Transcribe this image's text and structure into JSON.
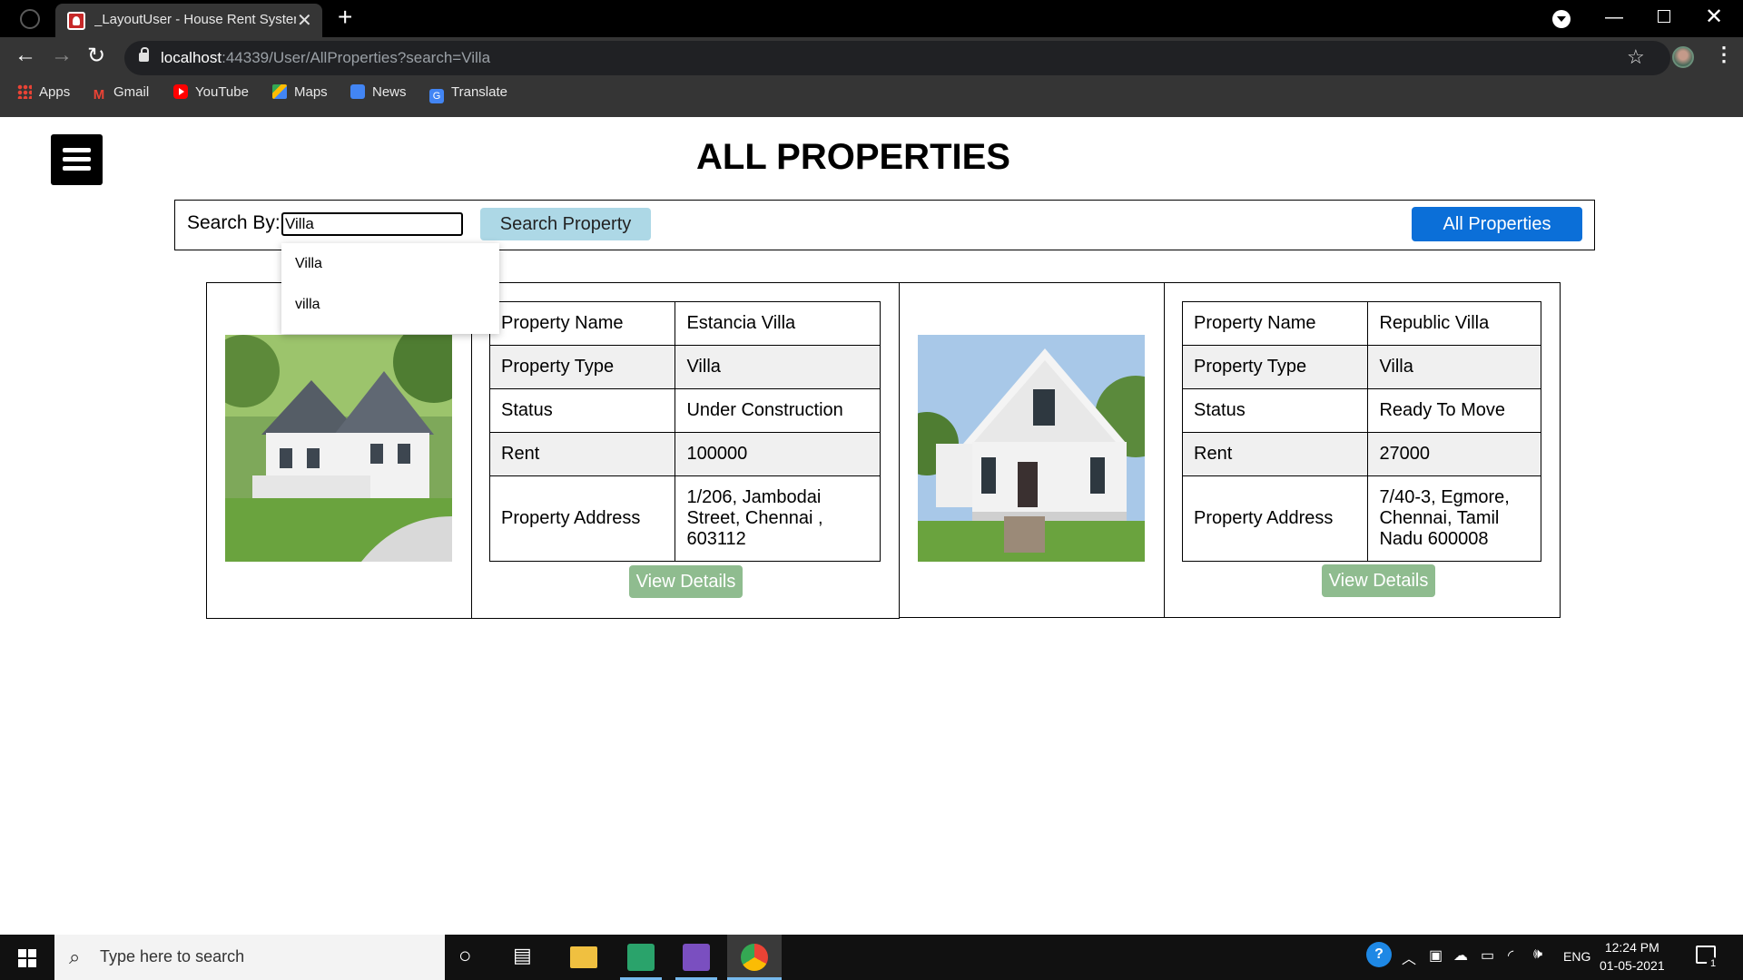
{
  "browser": {
    "tab_title": "_LayoutUser - House Rent System",
    "url_host": "localhost",
    "url_rest": ":44339/User/AllProperties?search=Villa",
    "bookmarks": [
      "Apps",
      "Gmail",
      "YouTube",
      "Maps",
      "News",
      "Translate"
    ]
  },
  "page": {
    "title": "ALL PROPERTIES",
    "search_label": "Search By:",
    "search_value": "Villa",
    "search_button": "Search Property",
    "all_button": "All Properties",
    "suggestions": [
      "Villa",
      "villa"
    ]
  },
  "properties": [
    {
      "rows": [
        {
          "label": "Property Name",
          "value": "Estancia Villa"
        },
        {
          "label": "Property Type",
          "value": "Villa"
        },
        {
          "label": "Status",
          "value": "Under Construction"
        },
        {
          "label": "Rent",
          "value": "100000"
        },
        {
          "label": "Property Address",
          "value": "1/206, Jambodai Street, Chennai , 603112"
        }
      ],
      "button": "View Details"
    },
    {
      "rows": [
        {
          "label": "Property Name",
          "value": "Republic Villa"
        },
        {
          "label": "Property Type",
          "value": "Villa"
        },
        {
          "label": "Status",
          "value": "Ready To Move"
        },
        {
          "label": "Rent",
          "value": "27000"
        },
        {
          "label": "Property Address",
          "value": "7/40-3, Egmore, Chennai, Tamil Nadu 600008"
        }
      ],
      "button": "View Details"
    }
  ],
  "taskbar": {
    "search_placeholder": "Type here to search",
    "language": "ENG",
    "time": "12:24 PM",
    "date": "01-05-2021",
    "notification_count": "1"
  }
}
